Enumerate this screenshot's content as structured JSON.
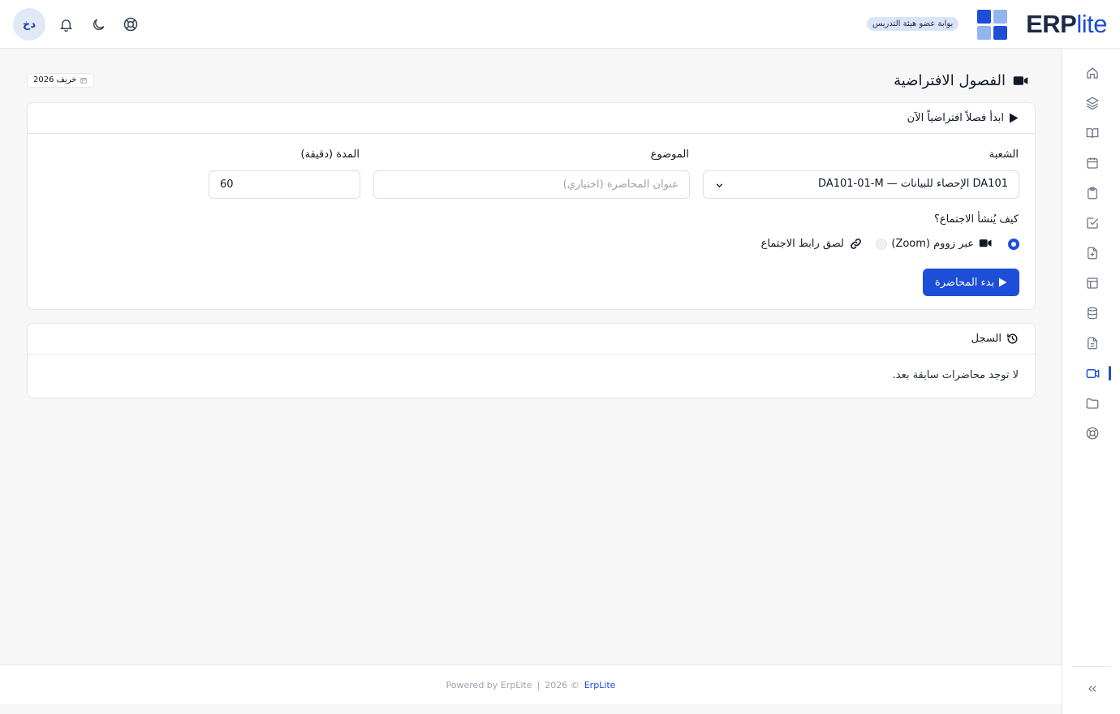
{
  "header": {
    "logo_bold": "ERP",
    "logo_light": "lite",
    "portal_badge": "بوابة عضو هيئة التدريس",
    "avatar_initials": "دخ",
    "icons": [
      "lifebuoy-icon",
      "moon-icon",
      "bell-icon"
    ]
  },
  "sidebar": {
    "items": [
      {
        "icon": "home-icon",
        "active": false
      },
      {
        "icon": "layers-icon",
        "active": false
      },
      {
        "icon": "book-icon",
        "active": false
      },
      {
        "icon": "calendar-icon",
        "active": false
      },
      {
        "icon": "clipboard-icon",
        "active": false
      },
      {
        "icon": "checkbox-icon",
        "active": false
      },
      {
        "icon": "file-plus-icon",
        "active": false
      },
      {
        "icon": "layout-icon",
        "active": false
      },
      {
        "icon": "database-icon",
        "active": false
      },
      {
        "icon": "document-icon",
        "active": false
      },
      {
        "icon": "video-icon",
        "active": true
      },
      {
        "icon": "folder-icon",
        "active": false
      },
      {
        "icon": "lifebuoy-icon",
        "active": false
      }
    ],
    "collapse_icon": "chevrons-left-icon"
  },
  "page": {
    "title": "الفصول الافتراضية",
    "semester": "خريف 2026"
  },
  "start_card": {
    "header": "ابدأ فصلاً افتراضياً الآن",
    "section_label": "الشعبة",
    "section_value": "DA101 الإحصاء للبيانات — DA101-01-M",
    "topic_label": "الموضوع",
    "topic_placeholder": "عنوان المحاضرة (اختياري)",
    "duration_label": "المدة (دقيقة)",
    "duration_value": "60",
    "meeting_question": "كيف يُنشأ الاجتماع؟",
    "option_zoom": "عبر زووم (Zoom)",
    "option_link": "لصق رابط الاجتماع",
    "selected_option": "zoom",
    "start_button": "بدء المحاضرة"
  },
  "history_card": {
    "header": "السجل",
    "empty_text": "لا توجد محاضرات سابقة بعد."
  },
  "footer": {
    "powered": "Powered by ErpLite",
    "separator": "|",
    "copyright": "2026 ©",
    "brand": "ErpLite"
  },
  "colors": {
    "primary": "#1d4ed8",
    "navy": "#1e2a44",
    "logo_light_tile": "#93b4ee",
    "badge_bg": "#dbe4f5"
  }
}
